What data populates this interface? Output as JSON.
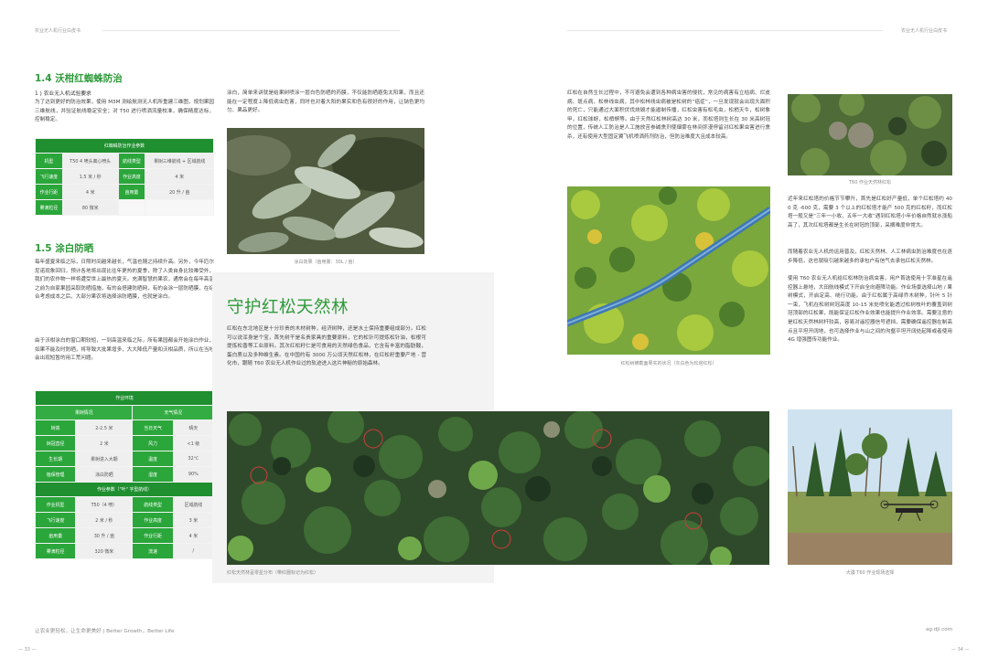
{
  "header": {
    "left_title": "农业无人机行业白皮书",
    "right_title": "农业无人机行业白皮书"
  },
  "section_14": {
    "heading": "1.4 沃柑红蜘蛛防治",
    "sub": "1 ) 农业无人机试验要求",
    "para": "为了达到更好的防治效果，使用 M3M 测绘航测无人机所重建三维图，规划果园三维航线，并验证航线稳定安全；对 T50 进行喷洒流量校准，确保精度达标，控制稳定。"
  },
  "table1": {
    "title": "红蜘蛛防治作业参数",
    "rows": [
      [
        "机型",
        "T50 4 喷头离心喷头",
        "航线类型",
        "果树三维航线 + 区域航线"
      ],
      [
        "飞行速度",
        "1.5 米 / 秒",
        "作业高度",
        "4 米"
      ],
      [
        "作业行距",
        "4 米",
        "亩用量",
        "20 升 / 亩"
      ],
      [
        "雾滴粒径",
        "80 微米",
        "",
        ""
      ]
    ]
  },
  "section_15": {
    "heading": "1.5 涂白防晒",
    "para1": "每年盛夏来临之际，日照时间越来越长，气温也随之持续升高。另外，今年厄尔尼诺现象回归，预计各地将出现比往年更热的夏季，除了人类自身比较难受外，我们的农作物一样将遭受世上最热的夏天。充满智慧的果农，通常会在每年高温之前为自家果园采取防晒措施，有的会搭建防晒网，有的会涂一层防晒膜，在综合考虑成本之后，大部分果农将选择涂防晒膜，也就是涂白。",
    "para2": "由于沃柑涂白的窗口期较短，一到高温来临之际，所有果园都会开始涂白作业，如果不能及时防晒，将导致大批果增多，大大降低产量和沃柑品质，所以在当地会出现短暂的用工荒问题。",
    "para_col2": "涂白，简单来讲就是给果树喷涂一层白色防晒的药膜，不仅能防晒避免太阳果，而且还能在一定程度上降低病虫危害，同时也对着大阳的果实和色有很好的作用，让钠色更均匀、果品更好。"
  },
  "table2": {
    "head": "作业环境",
    "subhead_left": "果树情况",
    "subhead_right": "天气情况",
    "env_rows": [
      [
        "树高",
        "2-2.5 米",
        "当日天气",
        "晴天"
      ],
      [
        "树冠直径",
        "2 米",
        "风力",
        "<1 级"
      ],
      [
        "生长期",
        "果树进入大期",
        "温度",
        "32℃"
      ],
      [
        "植保管理",
        "涂白防晒",
        "湿度",
        "90%"
      ]
    ],
    "sec2": "作业参数（\"叶\" 字型航线）",
    "param_rows": [
      [
        "作业机型",
        "T50（4 喷）",
        "航线类型",
        "区域航线"
      ],
      [
        "飞行速度",
        "2 米 / 秒",
        "作业高度",
        "3 米"
      ],
      [
        "亩用量",
        "30 升 / 亩",
        "作业行距",
        "4 米"
      ],
      [
        "雾滴粒径",
        "320 微米",
        "流速",
        "/"
      ]
    ]
  },
  "captions": {
    "coating": "涂白效果（亩用量：30L / 亩）",
    "aerial_big": "红松天然林呈零星分布（带红圈标记为红松）",
    "river": "红松树横截面果实的状况（灰白色为松塔红松）",
    "t60_top": "T60 作业天然林红松",
    "t60_site": "大疆 T60 作业现场选择"
  },
  "feature": {
    "title": "守护红松天然林",
    "para": "红松在东北地区是十分珍贵的木材树种，经济树种，还是水土保持重要组成部分。红松可以说浑身是个宝，首先树干是名贵家具的重要原料，它的松针可提炼松针油，松根可提炼松香等工业原料。其次红松籽仁是可食用的天然绿色食品，它含有丰富的脂肪酸，蛋白质以及多种维生素。在中国约有 3000 万公顷天然红松林，在红松籽重要产地 - 营化市，跟随 T60 农业无人机作业过的轨迹进入这片神秘的原始森林。"
  },
  "right_page": {
    "para1": "红松在自然生长过程中，不可避免会遭到各种病虫害的侵扰，常见的病害有立枯病、烂皮病、斑点病，松林线虫病，其中松林线虫病被是松树的“癌症”，一旦发现就会出现大面积的死亡，只能通过大面积伏伐烧毁才能遏制传播，红松虫害有松毛虫，松梢天牛，松树象甲，红松球蚜，松梢螟等。由于天然红松林树高达 30 米，而松塔则生长在 30 米高树冠的位置，传统人工防治是人工施放苦参碱熏剂使烟雾在林间弥漫停留对红松果虫害进行熏杀，还有使用大型固定翼飞机喷洒药剂防治，但防治难度大且成本较高。",
    "para2": "近年来红松塔的价格节节攀升，首先是红松好产量低，单个红松塔约 400 克 -600 克，需要 3 个以上的红松塔才能产 500 克的红松籽，而红松塔一般又是“三年一小收，五年一大收”遇到红松塔小年价格自然就水涨船高了，其次红松塔都是生长在树冠的顶部，采摘难度非常大。",
    "para3": "而随着农业无人机的运用普及，红松天然林、人工林病虫防治难度也在逐步降低，这也就吸引越来越多的承包户有信气去承包红松天然林。",
    "para4": "使用 T60 农业无人机给红松林防治病虫害，用户首选使用十字准星在遥控器上悬地，大田航线模式下开启全向避障功能。作业场景选择山地 / 果树模式，开启定高、绕行功能。由于红松属于高绿乔木树种，针叶 5 针一束，飞机在松树树冠高度 10-15 米处喷化能透过松树枝叶的覆盖到树冠顶部的红松果，既能保证红松作业效果也能提升作业效率。需要注意的是红松天然林树杆较高，容易对遥控器信号遮挡，需要确保遥控器在制高点且平坦开阔地，也可选择作业与山之间的沟壑平坦开阔处起降或者使用 4G 增强图传功能作业。"
  },
  "footer": {
    "slogan": "让农业更轻松，让生命更美好 | Better Growth，Better Life",
    "url": "ag.dji.com",
    "page_left": "— 33 —",
    "page_right": "— 34 —"
  }
}
